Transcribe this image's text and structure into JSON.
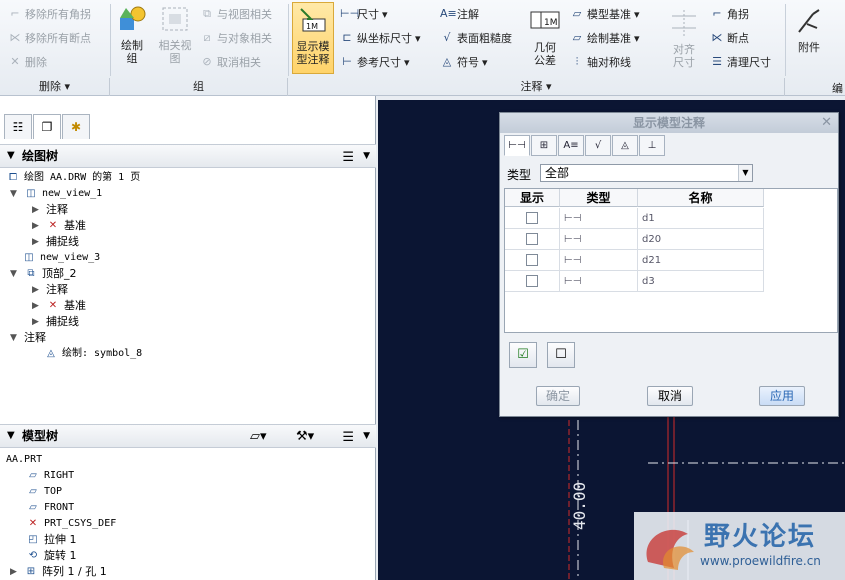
{
  "ribbon": {
    "delete_group": {
      "items": [
        "移除所有角拐",
        "移除所有断点",
        "删除"
      ],
      "label": "删除"
    },
    "group_group": {
      "draw_group": "绘制\n组",
      "related_view": "相关视\n图",
      "items": [
        "与视图相关",
        "与对象相关",
        "取消相关"
      ],
      "label": "组"
    },
    "annotate_group": {
      "show_model_annotations": "显示模\n型注释",
      "dimension": "尺寸",
      "ordinate_dimension": "纵坐标尺寸",
      "reference_dimension": "参考尺寸",
      "note": "注解",
      "surface_finish": "表面粗糙度",
      "symbol": "符号",
      "geometric_tolerance": "几何\n公差",
      "model_datum": "模型基准",
      "draw_datum": "绘制基准",
      "axis_symmetry": "轴对称线",
      "align_dimension": "对齐\n尺寸",
      "corner": "角拐",
      "breakpoint": "断点",
      "clean_dimensions": "清理尺寸",
      "label": "注释"
    },
    "attach": "附件",
    "edit_tail": "编"
  },
  "left_panel": {
    "drawing_tree": {
      "title": "绘图树",
      "rows": [
        {
          "text": "绘图 AA.DRW 的第 1 页"
        },
        {
          "text": "new_view_1"
        },
        {
          "text": "注释"
        },
        {
          "text": "基准"
        },
        {
          "text": "捕捉线"
        },
        {
          "text": "new_view_3"
        },
        {
          "text": "顶部_2"
        },
        {
          "text": "注释"
        },
        {
          "text": "基准"
        },
        {
          "text": "捕捉线"
        },
        {
          "text": "注释"
        },
        {
          "text": "绘制: symbol_8"
        }
      ]
    },
    "model_tree": {
      "title": "模型树",
      "rows": [
        {
          "text": "AA.PRT"
        },
        {
          "text": "RIGHT"
        },
        {
          "text": "TOP"
        },
        {
          "text": "FRONT"
        },
        {
          "text": "PRT_CSYS_DEF"
        },
        {
          "text": "拉伸 1"
        },
        {
          "text": "旋转 1"
        },
        {
          "text": "阵列 1 / 孔 1"
        }
      ]
    }
  },
  "dialog": {
    "title": "显示模型注释",
    "type_label": "类型",
    "type_value": "全部",
    "columns": {
      "show": "显示",
      "type": "类型",
      "name": "名称"
    },
    "rows": [
      {
        "name": "d1",
        "checked": false
      },
      {
        "name": "d20",
        "checked": false
      },
      {
        "name": "d21",
        "checked": false
      },
      {
        "name": "d3",
        "checked": false
      }
    ],
    "buttons": {
      "ok": "确定",
      "cancel": "取消",
      "apply": "应用"
    }
  },
  "canvas": {
    "dimension_text": "40.00"
  },
  "watermark": {
    "title": "野火论坛",
    "url": "www.proewildfire.cn"
  },
  "colors": {
    "canvas_bg": "#0b1533",
    "active_button": "#ffd36a",
    "dim_red": "#d12a2a"
  }
}
